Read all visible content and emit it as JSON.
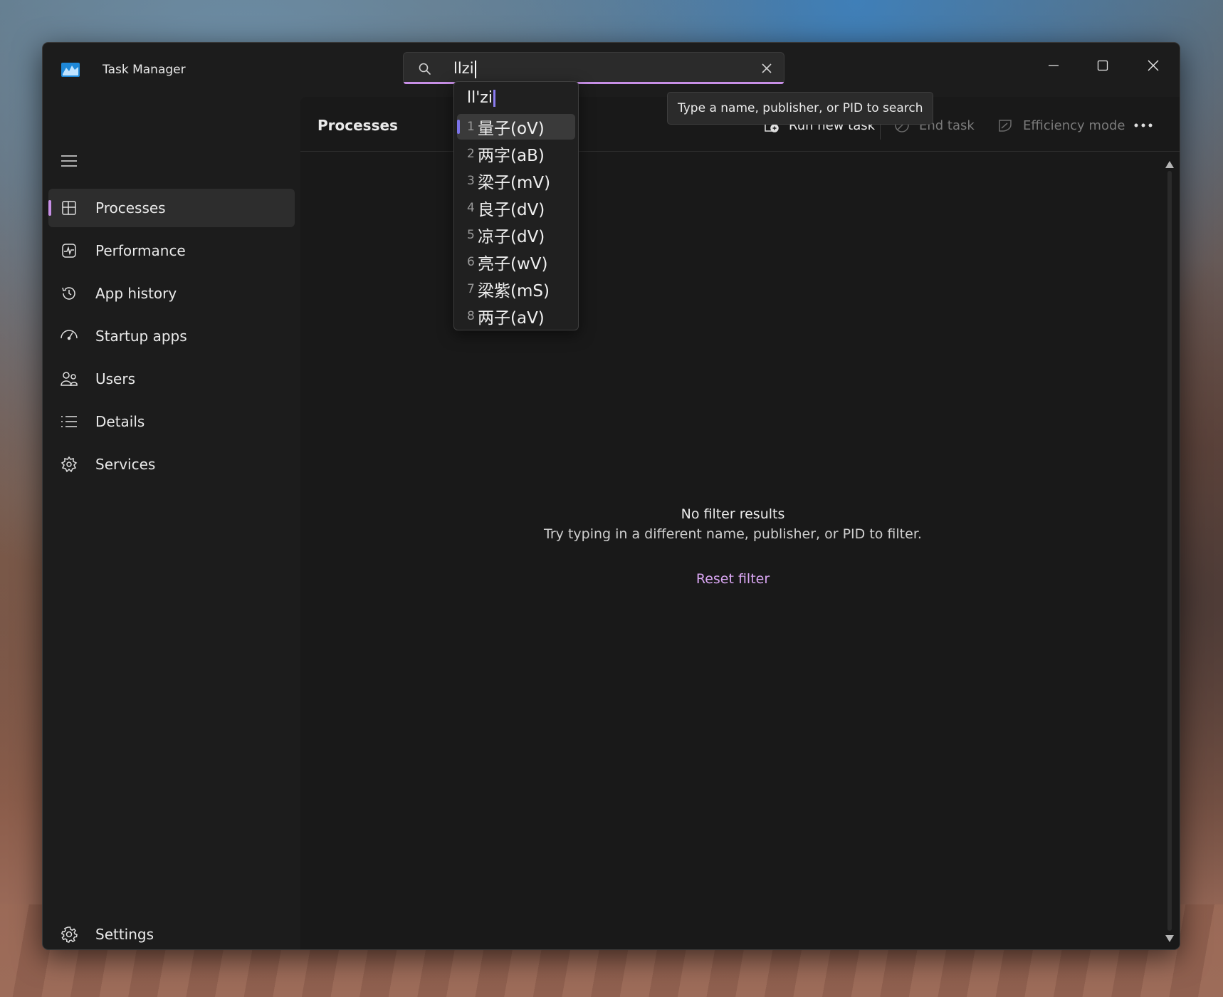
{
  "window": {
    "title": "Task Manager"
  },
  "search": {
    "value": "llzi",
    "tooltip": "Type a name, publisher, or PID to search"
  },
  "ime": {
    "composition": "ll'zi",
    "candidates": [
      {
        "num": "1",
        "text": "量子(oV)"
      },
      {
        "num": "2",
        "text": "两字(aB)"
      },
      {
        "num": "3",
        "text": "梁子(mV)"
      },
      {
        "num": "4",
        "text": "良子(dV)"
      },
      {
        "num": "5",
        "text": "凉子(dV)"
      },
      {
        "num": "6",
        "text": "亮子(wV)"
      },
      {
        "num": "7",
        "text": "梁紫(mS)"
      },
      {
        "num": "8",
        "text": "两子(aV)"
      }
    ]
  },
  "nav": {
    "items": [
      {
        "label": "Processes",
        "icon": "processes-icon"
      },
      {
        "label": "Performance",
        "icon": "performance-icon"
      },
      {
        "label": "App history",
        "icon": "app-history-icon"
      },
      {
        "label": "Startup apps",
        "icon": "startup-apps-icon"
      },
      {
        "label": "Users",
        "icon": "users-icon"
      },
      {
        "label": "Details",
        "icon": "details-icon"
      },
      {
        "label": "Services",
        "icon": "services-icon"
      }
    ],
    "settings": "Settings"
  },
  "content": {
    "title": "Processes",
    "commands": {
      "run_new_task": "Run new task",
      "end_task": "End task",
      "efficiency_mode": "Efficiency mode"
    },
    "empty": {
      "title": "No filter results",
      "subtitle": "Try typing in a different name, publisher, or PID to filter.",
      "reset": "Reset filter"
    }
  },
  "colors": {
    "accent": "#c78fe6",
    "ime_accent": "#7b73e8",
    "background": "#1c1c1c"
  }
}
